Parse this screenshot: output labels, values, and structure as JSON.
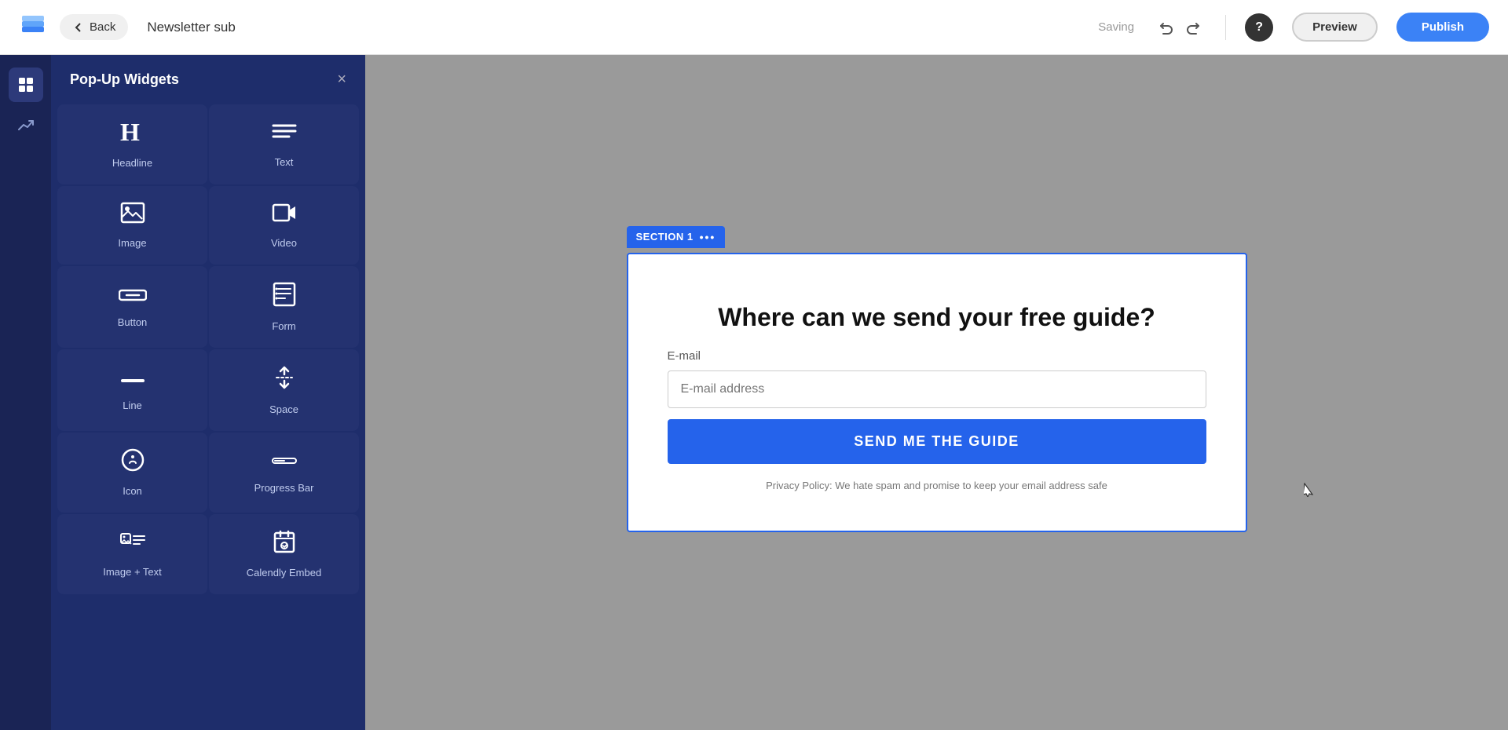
{
  "topbar": {
    "back_label": "Back",
    "title": "Newsletter sub",
    "saving_label": "Saving",
    "preview_label": "Preview",
    "publish_label": "Publish",
    "help_label": "?"
  },
  "sidebar": {
    "icons": [
      {
        "name": "widgets-icon",
        "symbol": "⊞",
        "active": true
      },
      {
        "name": "analytics-icon",
        "symbol": "📈",
        "active": false
      }
    ]
  },
  "widget_panel": {
    "title": "Pop-Up Widgets",
    "close_label": "×",
    "widgets": [
      {
        "name": "headline",
        "label": "Headline",
        "icon": "H"
      },
      {
        "name": "text",
        "label": "Text",
        "icon": "≡"
      },
      {
        "name": "image",
        "label": "Image",
        "icon": "🖼"
      },
      {
        "name": "video",
        "label": "Video",
        "icon": "🎥"
      },
      {
        "name": "button",
        "label": "Button",
        "icon": "▬"
      },
      {
        "name": "form",
        "label": "Form",
        "icon": "📋"
      },
      {
        "name": "line",
        "label": "Line",
        "icon": "—"
      },
      {
        "name": "space",
        "label": "Space",
        "icon": "↑↓"
      },
      {
        "name": "icon-widget",
        "label": "Icon",
        "icon": "☺"
      },
      {
        "name": "progress-bar",
        "label": "Progress Bar",
        "icon": "▦"
      },
      {
        "name": "image-text",
        "label": "Image + Text",
        "icon": "🖼≡"
      },
      {
        "name": "calendly-embed",
        "label": "Calendly Embed",
        "icon": "📅"
      }
    ]
  },
  "popup": {
    "section_label": "SECTION 1",
    "heading": "Where can we send your free guide?",
    "email_label": "E-mail",
    "email_placeholder": "E-mail address",
    "submit_label": "SEND ME THE GUIDE",
    "privacy_text": "Privacy Policy: We hate spam and promise to keep your email address safe"
  }
}
